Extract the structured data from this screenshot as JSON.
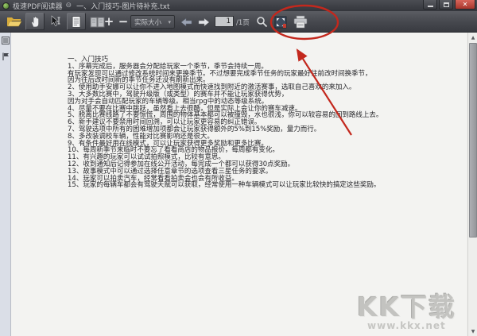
{
  "window": {
    "app_title": "极速PDF阅读器",
    "doc_title": "一、入门技巧-图片待补充.txt"
  },
  "glyphs": {
    "menu_circle": "⊖",
    "close": "✕",
    "zoom_in": "+",
    "zoom_out": "−",
    "dropdown_caret": "▾",
    "scroll_up": "▲",
    "scroll_down": "▼"
  },
  "toolbar": {
    "zoom_level_value": "实际大小",
    "page_value": "1",
    "page_total_label": "/1页"
  },
  "document": {
    "lines": [
      "一、入门技巧",
      "1、序幕完成后，服务器会分配给玩家一个季节，季节会持续一周。",
      "有玩家发现可以通过修改系统时间来更换季节。不过想要完成季节任务的玩家最好往前改时间换季节，",
      "因为往后改时间新的季节任务还没有刷新出来。",
      "2、使用助手安娜可以让你不进入地图模式而快速找到附近的激活赛事，选取自己喜欢的来加入。",
      "3、大多数比赛中，驾驶升级版（或类型）的赛车并不能让玩家获得优势，",
      "因为对手会自动匹配玩家的车辆等级。相当rpg中的动态等级系统。",
      "4、尽量不要在比赛中跳跃，虽然看上去很酷，但是实际上会让你的赛车减速。",
      "5、脱离比赛线路了不要惊慌，周围的物体基本都可以被撞毁，水也很浅，你可以较容易的回到路线上去。",
      "6、新手建议不要禁用时间回溯，可以让玩家更容易的纠正错误。",
      "7、驾驶选项中所有的困难增加项都会让玩家获得额外的5%到15%奖励，量力而行。",
      "8、多改装调校车辆，性能对比赛影响还是很大。",
      "9、有条件最好用在线模式，可以让玩家获得更多奖励和更多比赛。",
      "10、每周新季节来临时不要忘了看看商店的物品报价，每周都有变化。",
      "11、有兴趣的玩家可以试试拍照模式，比较有意思。",
      "12、收到通知后记得参加在线公开活动，每完成一个都可以获得30点奖励。",
      "13、故事模式中可以通过选择任意章节的选项查看三星任务的要求。",
      "14、玩家可以拍卖汽车，经常看看拍卖会也会有所收益。",
      "15、玩家的每辆车都会有驾驶天赋可以获取，经常使用一种车辆模式可以让玩家比较快的搞定这些奖励。"
    ]
  },
  "watermark": {
    "line1": "KK下载",
    "line2": "www.kkx.net"
  },
  "colors": {
    "annotation_red": "#c3281d",
    "close_red": "#b5453c",
    "folder_yellow": "#e9c050"
  }
}
